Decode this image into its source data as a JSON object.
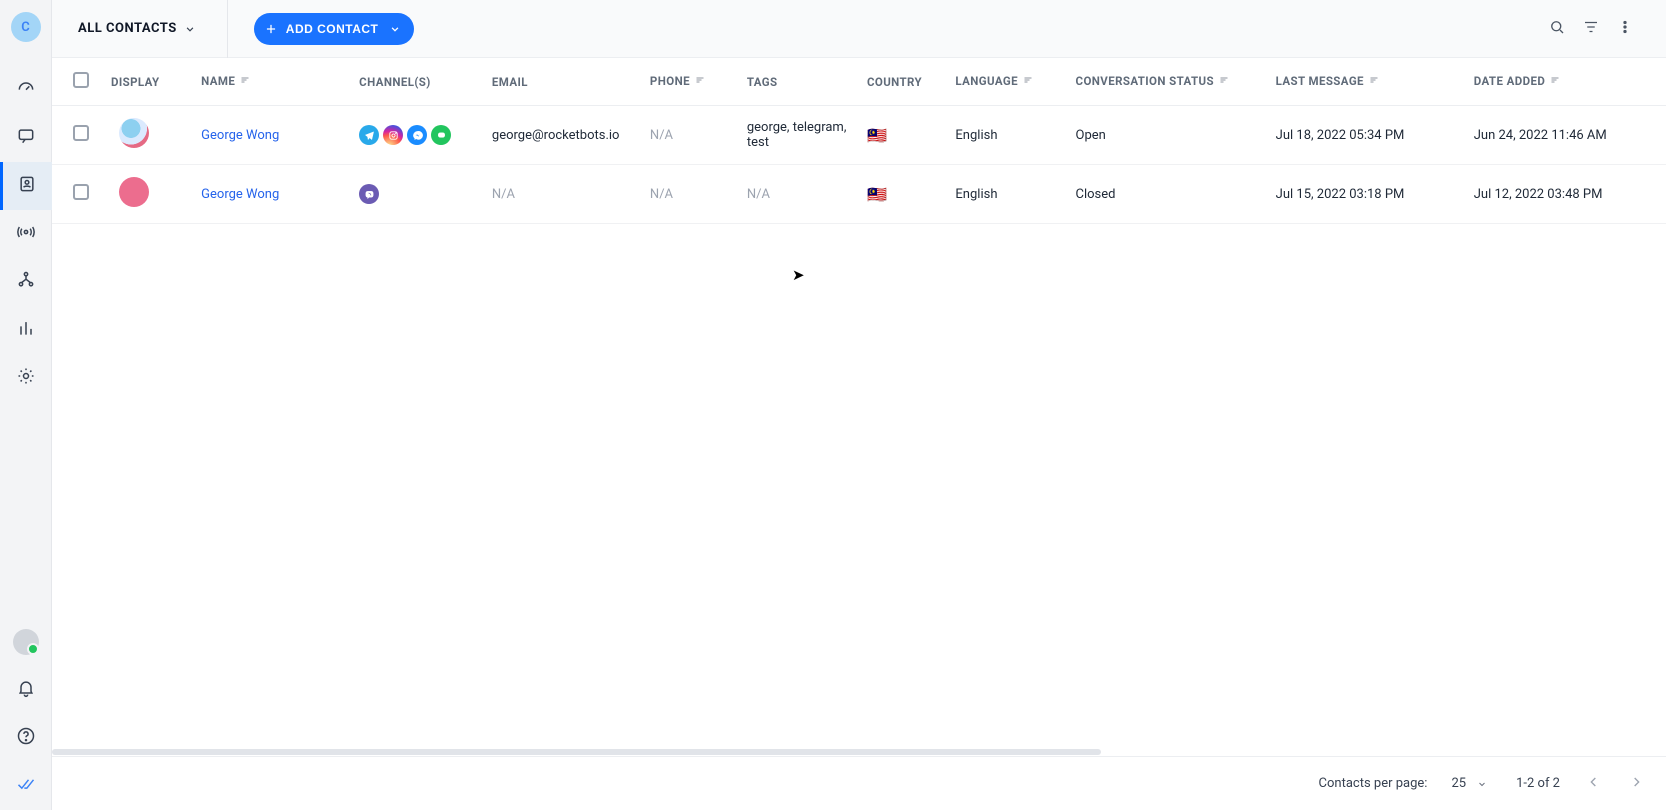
{
  "workspace_initial": "C",
  "segment_label": "ALL CONTACTS",
  "add_contact_label": "ADD CONTACT",
  "columns": {
    "display": "DISPLAY",
    "name": "NAME",
    "channels": "CHANNEL(S)",
    "email": "EMAIL",
    "phone": "PHONE",
    "tags": "TAGS",
    "country": "COUNTRY",
    "language": "LANGUAGE",
    "status": "CONVERSATION STATUS",
    "last_message": "LAST MESSAGE",
    "date_added": "DATE ADDED"
  },
  "rows": [
    {
      "name": "George Wong",
      "channels": [
        "telegram",
        "instagram",
        "messenger",
        "line"
      ],
      "email": "george@rocketbots.io",
      "phone": "N/A",
      "tags": "george, telegram, test",
      "country_flag": "🇲🇾",
      "language": "English",
      "status": "Open",
      "last_message": "Jul 18, 2022 05:34 PM",
      "date_added": "Jun 24, 2022 11:46 AM",
      "avatar_class": "a1"
    },
    {
      "name": "George Wong",
      "channels": [
        "viber"
      ],
      "email": "N/A",
      "phone": "N/A",
      "tags": "N/A",
      "country_flag": "🇲🇾",
      "language": "English",
      "status": "Closed",
      "last_message": "Jul 15, 2022 03:18 PM",
      "date_added": "Jul 12, 2022 03:48 PM",
      "avatar_class": "a2"
    }
  ],
  "footer": {
    "per_page_label": "Contacts per page:",
    "per_page_value": "25",
    "range_text": "1-2 of 2"
  }
}
